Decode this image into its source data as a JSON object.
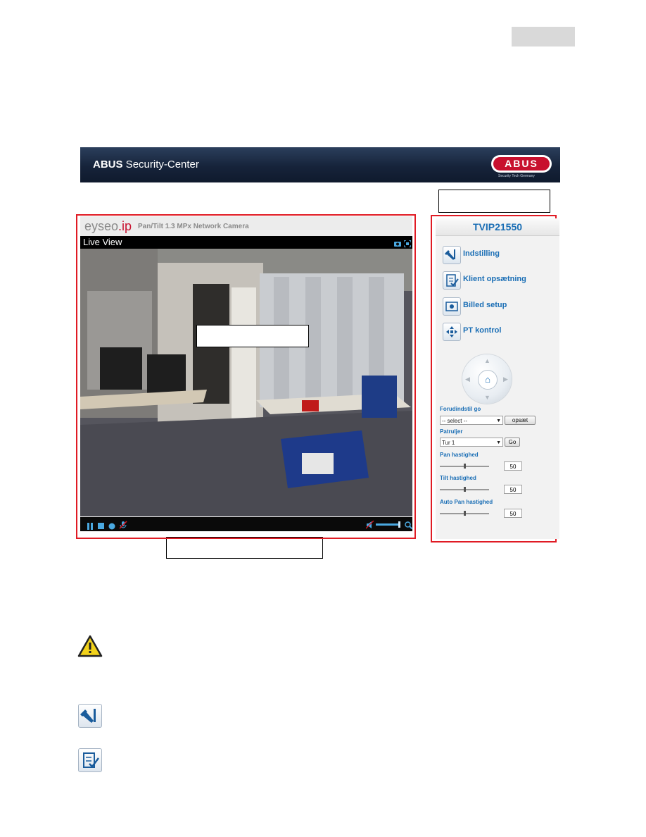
{
  "banner": {
    "brand_bold": "ABUS",
    "brand_rest": " Security-Center",
    "logo_text": "ABUS",
    "logo_sub": "Security Tech Germany"
  },
  "camera": {
    "brand_prefix": "eyseo",
    "brand_suffix": ".ip",
    "model_line": "Pan/Tilt 1.3 MPx Network Camera",
    "live_view_label": "Live View"
  },
  "sidebar": {
    "title": "TVIP21550",
    "menu": [
      {
        "label": "Indstilling",
        "icon": "tools-icon"
      },
      {
        "label": "Klient opsætning",
        "icon": "checklist-icon"
      },
      {
        "label": "Billed setup",
        "icon": "image-icon"
      },
      {
        "label": "PT kontrol",
        "icon": "move-icon"
      }
    ],
    "preset_label": "Forudindstil go",
    "preset_select": "-- select --",
    "preset_button": "opsæt",
    "patrol_label": "Patruljer",
    "patrol_select": "Tur 1",
    "patrol_button": "Go",
    "pan_speed_label": "Pan hastighed",
    "pan_speed_value": "50",
    "tilt_speed_label": "Tilt hastighed",
    "tilt_speed_value": "50",
    "auto_pan_label": "Auto Pan hastighed",
    "auto_pan_value": "50",
    "speeds": {
      "pan": 0.5,
      "tilt": 0.5,
      "auto_pan": 0.5
    }
  },
  "colors": {
    "accent": "#1a6eb5",
    "highlight_frame": "#e01b24",
    "banner": "#16233a",
    "logo_red": "#c8102e"
  }
}
